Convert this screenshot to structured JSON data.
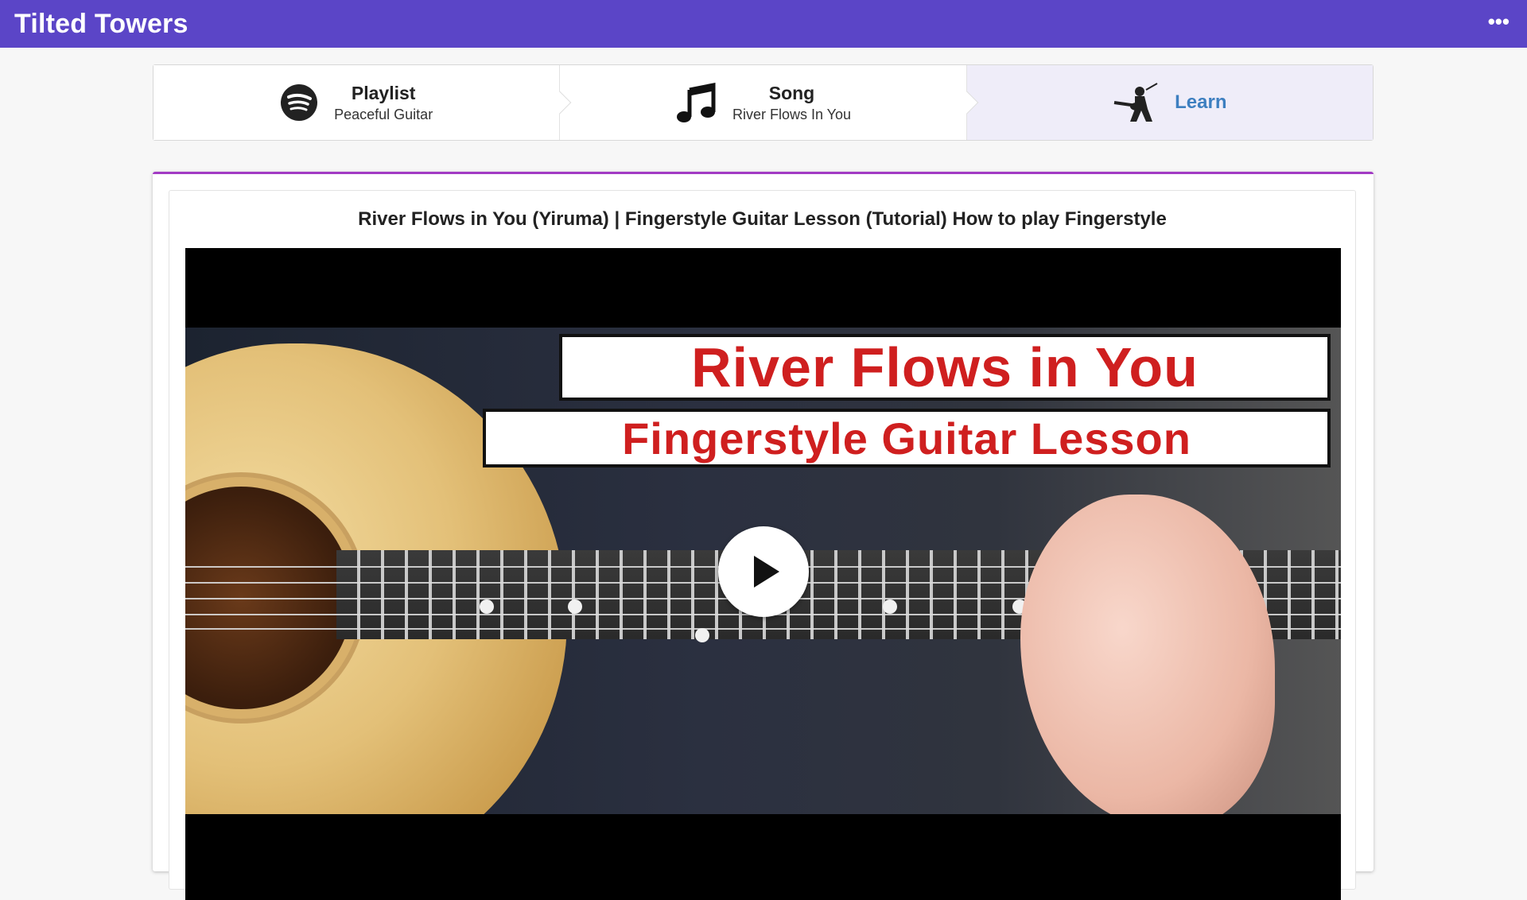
{
  "app": {
    "title": "Tilted Towers",
    "menu_glyph": "•••"
  },
  "steps": [
    {
      "title": "Playlist",
      "subtitle": "Peaceful Guitar",
      "icon": "spotify-icon"
    },
    {
      "title": "Song",
      "subtitle": "River Flows In You",
      "icon": "music-note-icon"
    },
    {
      "title": "Learn",
      "icon": "guitar-player-icon",
      "active": true
    }
  ],
  "video": {
    "title": "River Flows in You (Yiruma) | Fingerstyle Guitar Lesson (Tutorial) How to play Fingerstyle",
    "thumbnail": {
      "banner_line_1": "River Flows in You",
      "banner_line_2": "Fingerstyle Guitar Lesson"
    },
    "play_icon": "play-icon"
  },
  "colors": {
    "topbar": "#5b45c7",
    "active_step": "#efedf9",
    "learn_link": "#3d7fc0",
    "panel_accent": "#a23bc4",
    "banner_text": "#cf1f1f"
  }
}
